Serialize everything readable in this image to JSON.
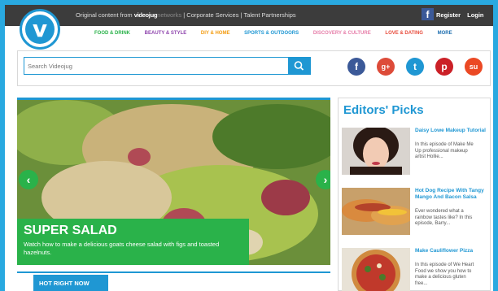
{
  "topbar": {
    "prefix": "Original content from",
    "brand_bold": "videojug",
    "brand_light": "networks",
    "links_rest": " | Corporate Services | Talent Partnerships",
    "register": "Register",
    "login": "Login",
    "fb_glyph": "f"
  },
  "logo": {
    "letter": "v"
  },
  "nav": [
    {
      "label": "FOOD & DRINK",
      "color": "#2ab24a"
    },
    {
      "label": "BEAUTY & STYLE",
      "color": "#8e44ad"
    },
    {
      "label": "DIY & HOME",
      "color": "#f39c12"
    },
    {
      "label": "SPORTS & OUTDOORS",
      "color": "#1f97d3"
    },
    {
      "label": "DISCOVERY & CULTURE",
      "color": "#e67ea9"
    },
    {
      "label": "LOVE & DATING",
      "color": "#e74c3c"
    },
    {
      "label": "MORE",
      "color": "#1f6fb0"
    }
  ],
  "search": {
    "placeholder": "Search Videojug"
  },
  "social": [
    {
      "name": "facebook-icon",
      "glyph": "f",
      "color": "#3b5998"
    },
    {
      "name": "google-plus-icon",
      "glyph": "g+",
      "color": "#dd4b39"
    },
    {
      "name": "twitter-icon",
      "glyph": "t",
      "color": "#1f97d3"
    },
    {
      "name": "pinterest-icon",
      "glyph": "p",
      "color": "#cb2027"
    },
    {
      "name": "stumbleupon-icon",
      "glyph": "su",
      "color": "#eb4924"
    }
  ],
  "hero": {
    "title": "SUPER SALAD",
    "description": "Watch how to make a delicious goats cheese salad with figs and toasted hazelnuts.",
    "prev": "‹",
    "next": "›"
  },
  "hot_tab": "HOT RIGHT NOW",
  "editors_picks": {
    "heading": "Editors' Picks",
    "items": [
      {
        "title": "Daisy Lowe Makeup Tutorial",
        "desc": "In this episode of Make Me Up professional makeup artist Hollie..."
      },
      {
        "title": "Hot Dog Recipe With Tangy Mango And Bacon Salsa",
        "desc": "Ever wondered what a rainbow tastes like? In this episode, Barry..."
      },
      {
        "title": "Make Cauliflower Pizza",
        "desc": "In this episode of We Heart Food we show you how to make a delicious gluten free..."
      }
    ]
  },
  "colors": {
    "accent": "#1f97d3",
    "green": "#2ab24a",
    "topbar": "#3c3c3c"
  }
}
